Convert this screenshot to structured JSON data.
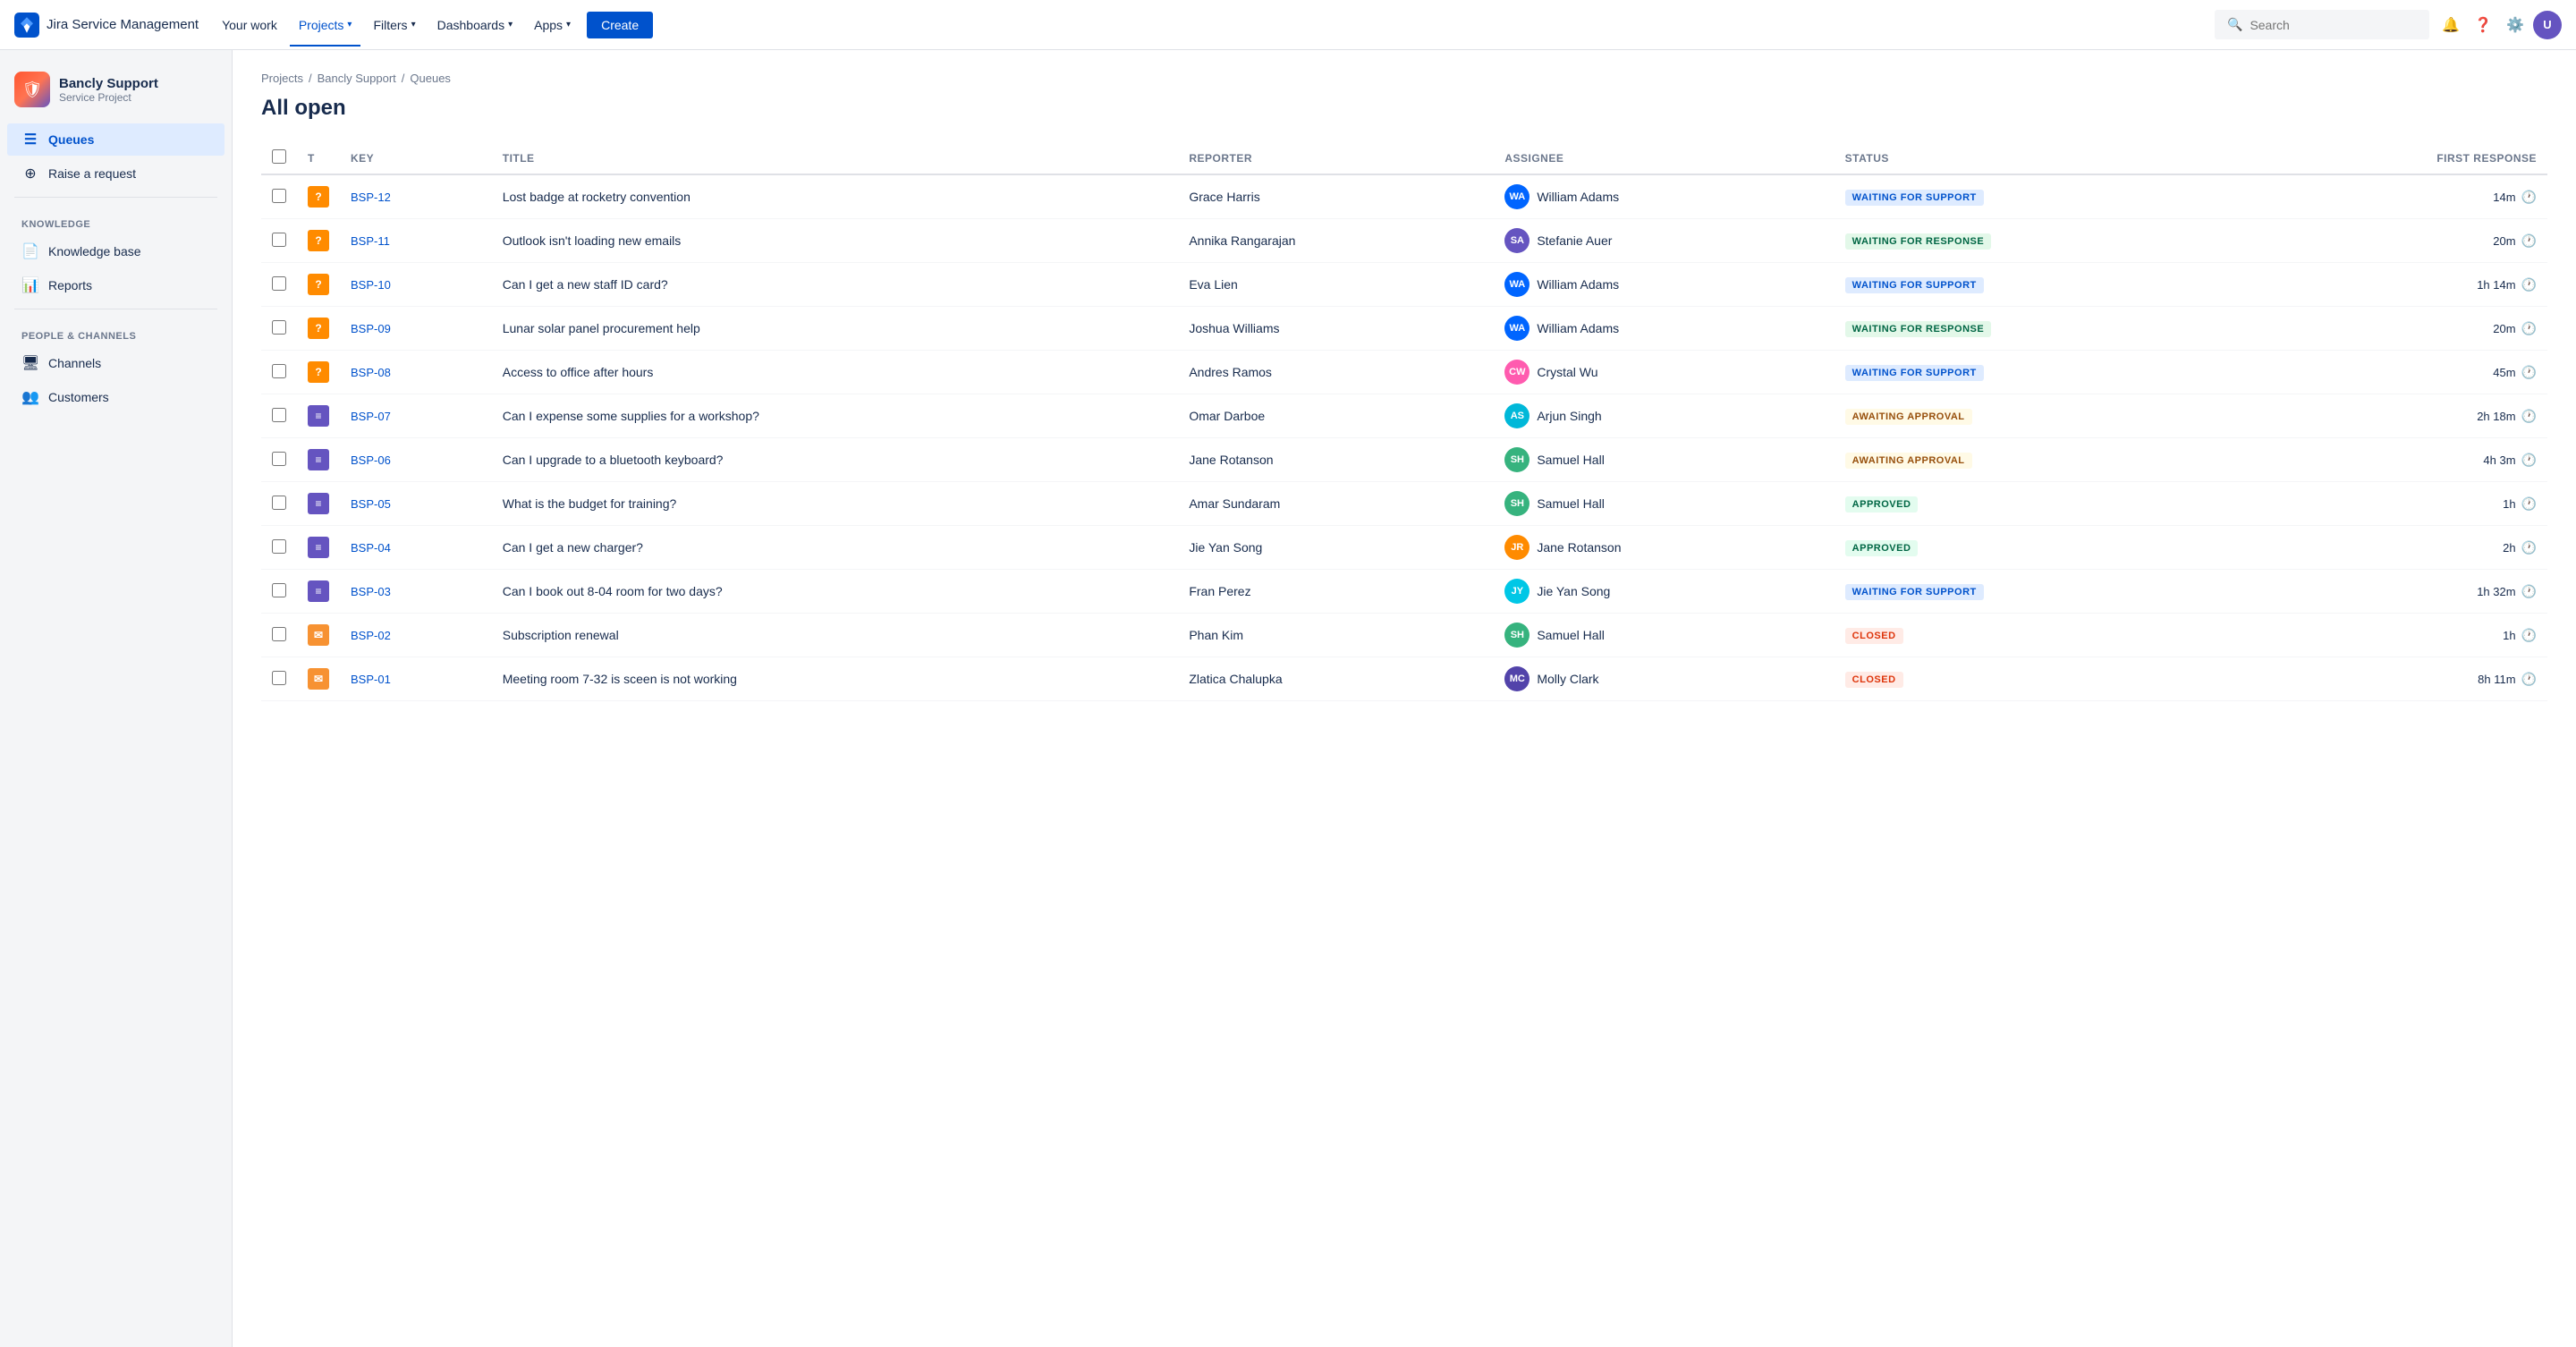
{
  "app": {
    "name": "Jira Service Management"
  },
  "topnav": {
    "your_work": "Your work",
    "projects": "Projects",
    "filters": "Filters",
    "dashboards": "Dashboards",
    "apps": "Apps",
    "create": "Create",
    "search_placeholder": "Search"
  },
  "sidebar": {
    "project_name": "Bancly Support",
    "project_type": "Service Project",
    "queues_label": "Queues",
    "raise_label": "Raise a request",
    "knowledge_section": "KNOWLEDGE",
    "knowledge_base": "Knowledge base",
    "reports": "Reports",
    "people_section": "PEOPLE & CHANNELS",
    "channels": "Channels",
    "customers": "Customers"
  },
  "breadcrumb": {
    "projects": "Projects",
    "bancly": "Bancly Support",
    "queues": "Queues"
  },
  "page": {
    "title": "All open"
  },
  "table": {
    "columns": [
      "",
      "T",
      "Key",
      "Title",
      "Reporter",
      "Assignee",
      "Status",
      "First response"
    ],
    "rows": [
      {
        "key": "BSP-12",
        "type": "question",
        "title": "Lost badge at rocketry convention",
        "reporter": "Grace Harris",
        "assignee": "William Adams",
        "assignee_initials": "WA",
        "assignee_color": "av-blue",
        "status": "WAITING FOR SUPPORT",
        "status_class": "badge-waiting-support",
        "first_response": "14m"
      },
      {
        "key": "BSP-11",
        "type": "question",
        "title": "Outlook isn't loading new emails",
        "reporter": "Annika Rangarajan",
        "assignee": "Stefanie Auer",
        "assignee_initials": "SA",
        "assignee_color": "av-purple",
        "status": "WAITING FOR RESPONSE",
        "status_class": "badge-waiting-response",
        "first_response": "20m"
      },
      {
        "key": "BSP-10",
        "type": "question",
        "title": "Can I get a new staff ID card?",
        "reporter": "Eva Lien",
        "assignee": "William Adams",
        "assignee_initials": "WA",
        "assignee_color": "av-blue",
        "status": "WAITING FOR SUPPORT",
        "status_class": "badge-waiting-support",
        "first_response": "1h 14m"
      },
      {
        "key": "BSP-09",
        "type": "question",
        "title": "Lunar solar panel procurement help",
        "reporter": "Joshua Williams",
        "assignee": "William Adams",
        "assignee_initials": "WA",
        "assignee_color": "av-blue",
        "status": "WAITING FOR RESPONSE",
        "status_class": "badge-waiting-response",
        "first_response": "20m"
      },
      {
        "key": "BSP-08",
        "type": "question",
        "title": "Access to office after hours",
        "reporter": "Andres Ramos",
        "assignee": "Crystal Wu",
        "assignee_initials": "CW",
        "assignee_color": "av-pink",
        "status": "WAITING FOR SUPPORT",
        "status_class": "badge-waiting-support",
        "first_response": "45m"
      },
      {
        "key": "BSP-07",
        "type": "task",
        "title": "Can I expense some supplies for a workshop?",
        "reporter": "Omar Darboe",
        "assignee": "Arjun Singh",
        "assignee_initials": "AS",
        "assignee_color": "av-teal",
        "status": "AWAITING APPROVAL",
        "status_class": "badge-awaiting-approval",
        "first_response": "2h 18m"
      },
      {
        "key": "BSP-06",
        "type": "task",
        "title": "Can I upgrade to a bluetooth keyboard?",
        "reporter": "Jane Rotanson",
        "assignee": "Samuel Hall",
        "assignee_initials": "SH",
        "assignee_color": "av-green",
        "status": "AWAITING APPROVAL",
        "status_class": "badge-awaiting-approval",
        "first_response": "4h 3m"
      },
      {
        "key": "BSP-05",
        "type": "task",
        "title": "What is the budget for training?",
        "reporter": "Amar Sundaram",
        "assignee": "Samuel Hall",
        "assignee_initials": "SH",
        "assignee_color": "av-green",
        "status": "APPROVED",
        "status_class": "badge-approved",
        "first_response": "1h"
      },
      {
        "key": "BSP-04",
        "type": "task",
        "title": "Can I get a new charger?",
        "reporter": "Jie Yan Song",
        "assignee": "Jane Rotanson",
        "assignee_initials": "JR",
        "assignee_color": "av-orange",
        "status": "APPROVED",
        "status_class": "badge-approved",
        "first_response": "2h"
      },
      {
        "key": "BSP-03",
        "type": "task",
        "title": "Can I book out 8-04 room for two days?",
        "reporter": "Fran Perez",
        "assignee": "Jie Yan Song",
        "assignee_initials": "JY",
        "assignee_color": "av-cyan",
        "status": "WAITING FOR SUPPORT",
        "status_class": "badge-waiting-support",
        "first_response": "1h 32m"
      },
      {
        "key": "BSP-02",
        "type": "email",
        "title": "Subscription renewal",
        "reporter": "Phan Kim",
        "assignee": "Samuel Hall",
        "assignee_initials": "SH",
        "assignee_color": "av-green",
        "status": "CLOSED",
        "status_class": "badge-closed",
        "first_response": "1h"
      },
      {
        "key": "BSP-01",
        "type": "email",
        "title": "Meeting room 7-32 is sceen is not working",
        "reporter": "Zlatica Chalupka",
        "assignee": "Molly Clark",
        "assignee_initials": "MC",
        "assignee_color": "av-indigo",
        "status": "CLOSED",
        "status_class": "badge-closed",
        "first_response": "8h 11m"
      }
    ]
  }
}
